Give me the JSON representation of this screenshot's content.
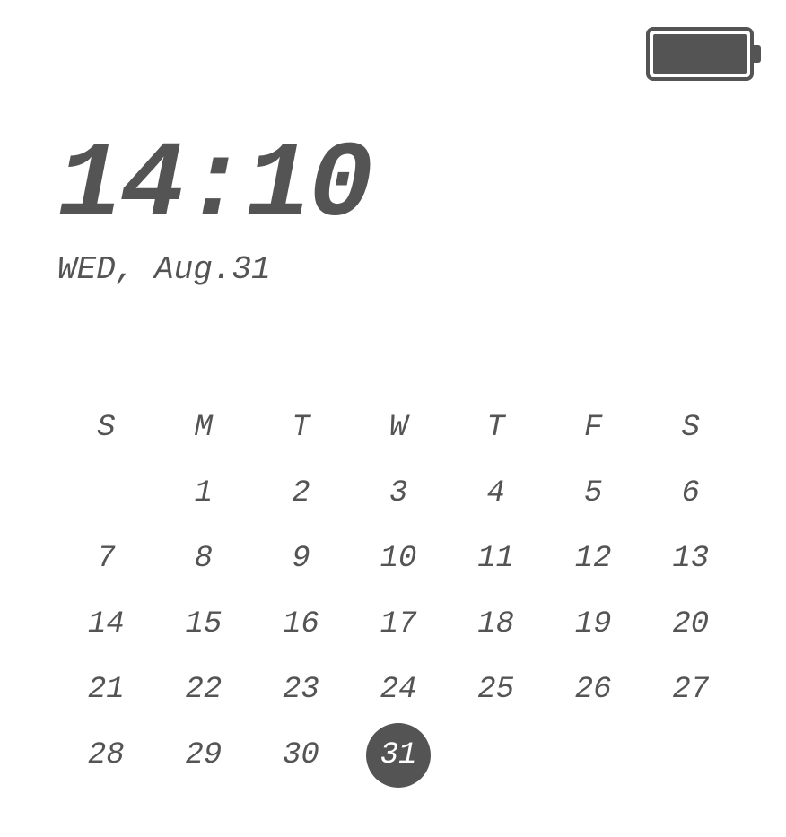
{
  "battery": {
    "level_percent": 100
  },
  "time": "14:10",
  "date_line": "WED, Aug.31",
  "calendar": {
    "day_headers": [
      "S",
      "M",
      "T",
      "W",
      "T",
      "F",
      "S"
    ],
    "weeks": [
      [
        "",
        "1",
        "2",
        "3",
        "4",
        "5",
        "6"
      ],
      [
        "7",
        "8",
        "9",
        "10",
        "11",
        "12",
        "13"
      ],
      [
        "14",
        "15",
        "16",
        "17",
        "18",
        "19",
        "20"
      ],
      [
        "21",
        "22",
        "23",
        "24",
        "25",
        "26",
        "27"
      ],
      [
        "28",
        "29",
        "30",
        "31",
        "",
        "",
        ""
      ]
    ],
    "current_day": "31"
  }
}
